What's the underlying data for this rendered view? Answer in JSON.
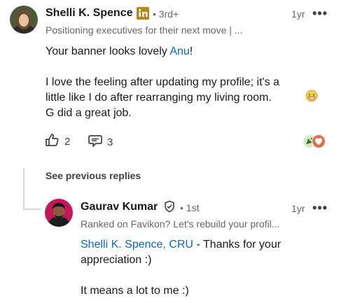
{
  "comment": {
    "author": "Shelli K. Spence",
    "degree": "3rd+",
    "time": "1yr",
    "headline": "Positioning executives for their next move | ...",
    "line1_prefix": "Your banner looks lovely ",
    "line1_mention": "Anu",
    "line1_suffix": "!",
    "para2_line1": "I love the feeling after updating my profile; it's a",
    "para2_line2": "little like I do after rearranging my living room.",
    "para2_line3": "G did a great job.",
    "like_count": "2",
    "reply_count": "3"
  },
  "see_previous": "See previous replies",
  "reply": {
    "author": "Gaurav Kumar",
    "degree": "1st",
    "time": "1yr",
    "headline": "Ranked on Favikon? Let's rebuild your profil...",
    "mention": "Shelli K. Spence, CRU",
    "line1_suffix": " - Thanks for your",
    "line2": "appreciation :)",
    "line3": "It means a lot to me :)"
  },
  "colors": {
    "link": "#0a66c2",
    "linkedin_badge": "#b3891d",
    "reaction_heart": "#df704d",
    "reaction_celebrate": "#44712e"
  },
  "icons": [
    "linkedin-premium-icon",
    "more-icon",
    "thumbs-up-icon",
    "comment-icon",
    "celebrate-reaction-icon",
    "love-reaction-icon",
    "verified-shield-icon",
    "grin-emoji-icon"
  ]
}
